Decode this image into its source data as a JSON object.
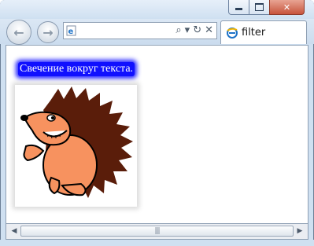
{
  "window": {
    "controls": {
      "minimize": "minimize",
      "maximize": "maximize",
      "close": "close"
    }
  },
  "nav": {
    "back_icon": "back-arrow-icon",
    "forward_icon": "forward-arrow-icon",
    "address_value": "",
    "address_tools": [
      "search-icon",
      "dropdown-icon",
      "refresh-icon",
      "stop-icon"
    ]
  },
  "tab": {
    "label": "filter"
  },
  "page": {
    "glow_text": "Свечение вокруг текста.",
    "glow_color": "#1010ff",
    "image_name": "hedgehog-image"
  }
}
